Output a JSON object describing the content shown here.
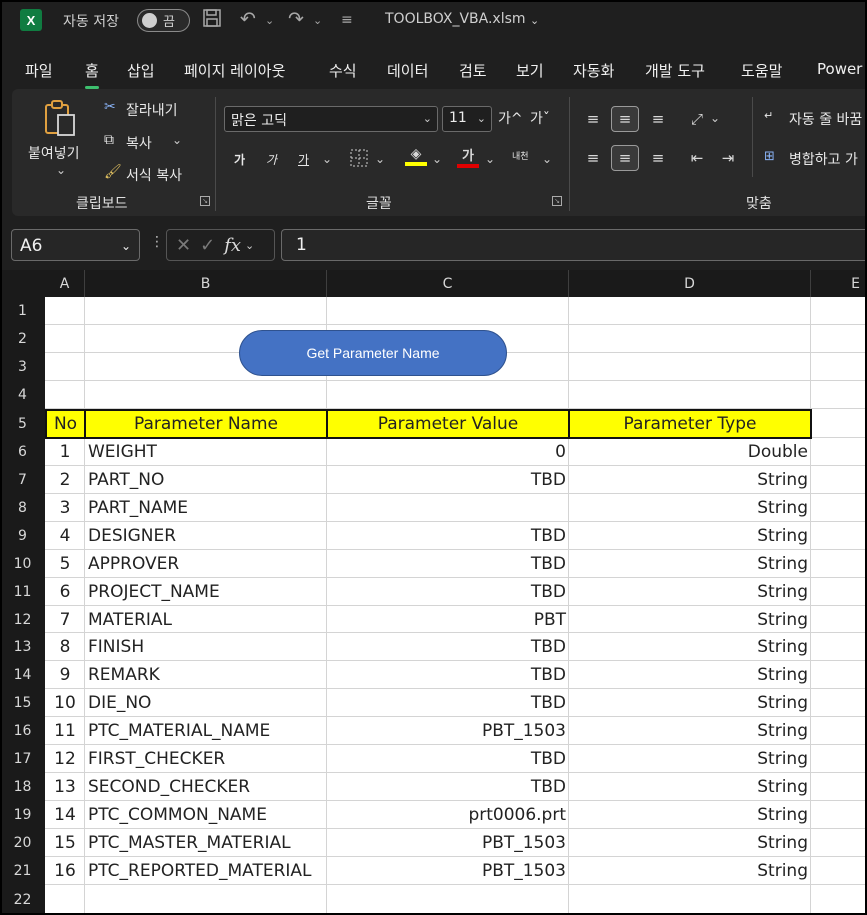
{
  "titlebar": {
    "app_icon": "X",
    "autosave_label": "자동 저장",
    "autosave_state": "끔",
    "filename": "TOOLBOX_VBA.xlsm",
    "icons": [
      "save-icon",
      "undo-icon",
      "redo-icon",
      "customize-icon"
    ]
  },
  "menu": {
    "tabs": [
      "파일",
      "홈",
      "삽입",
      "페이지 레이아웃",
      "수식",
      "데이터",
      "검토",
      "보기",
      "자동화",
      "개발 도구",
      "도움말",
      "Power"
    ],
    "active": "홈"
  },
  "ribbon": {
    "clipboard": {
      "paste": "붙여넣기",
      "cut": "잘라내기",
      "copy": "복사",
      "format_painter": "서식 복사",
      "group": "클립보드"
    },
    "font": {
      "name": "맑은 고딕",
      "size": "11",
      "bold": "가",
      "italic": "가",
      "underline": "가",
      "grow": "가^",
      "shrink": "가ˇ",
      "phonetic": "내천",
      "color_glyph": "가",
      "group": "글꼴",
      "fill_color": "#ffff00",
      "font_color": "#e00000"
    },
    "alignment": {
      "wrap": "자동 줄 바꿈",
      "merge": "병합하고 가",
      "group": "맞춤"
    }
  },
  "formula_bar": {
    "name_box": "A6",
    "fx": "fx",
    "value": "1"
  },
  "columns": [
    "A",
    "B",
    "C",
    "D",
    "E"
  ],
  "rows": [
    "1",
    "2",
    "3",
    "4",
    "5",
    "6",
    "7",
    "8",
    "9",
    "10",
    "11",
    "12",
    "13",
    "14",
    "15",
    "16",
    "17",
    "18",
    "19",
    "20",
    "21",
    "22"
  ],
  "sheet": {
    "button_label": "Get Parameter Name",
    "headers": [
      "No",
      "Parameter Name",
      "Parameter Value",
      "Parameter Type"
    ],
    "header_color": "#ffff00",
    "data": [
      {
        "no": "1",
        "name": "WEIGHT",
        "value": "0",
        "type": "Double"
      },
      {
        "no": "2",
        "name": "PART_NO",
        "value": "TBD",
        "type": "String"
      },
      {
        "no": "3",
        "name": "PART_NAME",
        "value": "",
        "type": "String"
      },
      {
        "no": "4",
        "name": "DESIGNER",
        "value": "TBD",
        "type": "String"
      },
      {
        "no": "5",
        "name": "APPROVER",
        "value": "TBD",
        "type": "String"
      },
      {
        "no": "6",
        "name": "PROJECT_NAME",
        "value": "TBD",
        "type": "String"
      },
      {
        "no": "7",
        "name": "MATERIAL",
        "value": "PBT",
        "type": "String"
      },
      {
        "no": "8",
        "name": "FINISH",
        "value": "TBD",
        "type": "String"
      },
      {
        "no": "9",
        "name": "REMARK",
        "value": "TBD",
        "type": "String"
      },
      {
        "no": "10",
        "name": "DIE_NO",
        "value": "TBD",
        "type": "String"
      },
      {
        "no": "11",
        "name": "PTC_MATERIAL_NAME",
        "value": "PBT_1503",
        "type": "String"
      },
      {
        "no": "12",
        "name": "FIRST_CHECKER",
        "value": "TBD",
        "type": "String"
      },
      {
        "no": "13",
        "name": "SECOND_CHECKER",
        "value": "TBD",
        "type": "String"
      },
      {
        "no": "14",
        "name": "PTC_COMMON_NAME",
        "value": "prt0006.prt",
        "type": "String"
      },
      {
        "no": "15",
        "name": "PTC_MASTER_MATERIAL",
        "value": "PBT_1503",
        "type": "String"
      },
      {
        "no": "16",
        "name": "PTC_REPORTED_MATERIAL",
        "value": "PBT_1503",
        "type": "String"
      }
    ]
  }
}
